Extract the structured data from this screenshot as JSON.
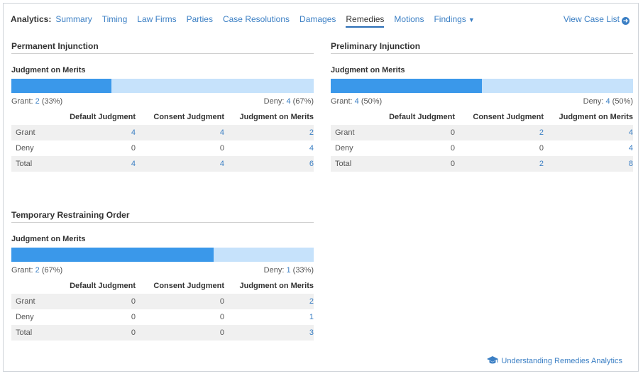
{
  "nav": {
    "label": "Analytics:",
    "tabs": [
      "Summary",
      "Timing",
      "Law Firms",
      "Parties",
      "Case Resolutions",
      "Damages",
      "Remedies",
      "Motions",
      "Findings"
    ],
    "active": "Remedies",
    "view_case_list": "View Case List"
  },
  "columns": [
    "Default Judgment",
    "Consent Judgment",
    "Judgment on Merits"
  ],
  "panels": [
    {
      "title": "Permanent Injunction",
      "subtitle": "Judgment on Merits",
      "grant_fraction": 0.33,
      "grant_label": "Grant:",
      "grant_value": "2",
      "grant_pct": "(33%)",
      "deny_label": "Deny:",
      "deny_value": "4",
      "deny_pct": "(67%)",
      "rows": [
        {
          "label": "Grant",
          "values": [
            "4",
            "4",
            "2"
          ]
        },
        {
          "label": "Deny",
          "values": [
            "0",
            "0",
            "4"
          ]
        },
        {
          "label": "Total",
          "values": [
            "4",
            "4",
            "6"
          ]
        }
      ]
    },
    {
      "title": "Preliminary Injunction",
      "subtitle": "Judgment on Merits",
      "grant_fraction": 0.5,
      "grant_label": "Grant:",
      "grant_value": "4",
      "grant_pct": "(50%)",
      "deny_label": "Deny:",
      "deny_value": "4",
      "deny_pct": "(50%)",
      "rows": [
        {
          "label": "Grant",
          "values": [
            "0",
            "2",
            "4"
          ]
        },
        {
          "label": "Deny",
          "values": [
            "0",
            "0",
            "4"
          ]
        },
        {
          "label": "Total",
          "values": [
            "0",
            "2",
            "8"
          ]
        }
      ]
    },
    {
      "title": "Temporary Restraining Order",
      "subtitle": "Judgment on Merits",
      "grant_fraction": 0.67,
      "grant_label": "Grant:",
      "grant_value": "2",
      "grant_pct": "(67%)",
      "deny_label": "Deny:",
      "deny_value": "1",
      "deny_pct": "(33%)",
      "rows": [
        {
          "label": "Grant",
          "values": [
            "0",
            "0",
            "2"
          ]
        },
        {
          "label": "Deny",
          "values": [
            "0",
            "0",
            "1"
          ]
        },
        {
          "label": "Total",
          "values": [
            "0",
            "0",
            "3"
          ]
        }
      ]
    }
  ],
  "footer": {
    "link": "Understanding Remedies Analytics",
    "icon": "graduation-cap-icon"
  },
  "colors": {
    "link": "#3b7fc4",
    "bar_fill": "#3a98ea",
    "bar_track": "#c6e2fb",
    "row_shade": "#f0f0f0"
  }
}
